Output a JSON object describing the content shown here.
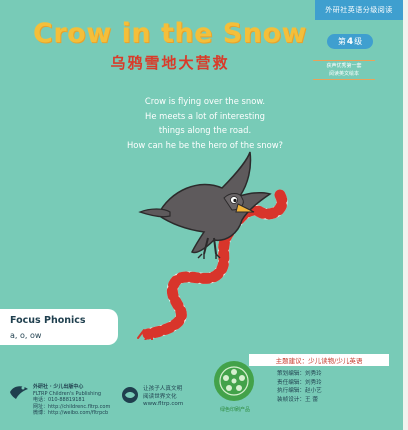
{
  "series_tab": "外研社英语分级阅读",
  "level": {
    "prefix": "第",
    "number": "4",
    "suffix": "级"
  },
  "award": [
    "获声优秀第一套",
    "阅读英文绘本"
  ],
  "title": "Crow in the Snow",
  "cn_title": "乌鸦雪地大营救",
  "blurb": [
    "Crow is flying over the snow.",
    "He meets a lot of interesting",
    "things along the road.",
    "How can he be the hero of the snow?"
  ],
  "phonics": {
    "title": "Focus Phonics",
    "sounds": "a, o, ow"
  },
  "ages": "主题建议：少儿读物/少儿英语",
  "credits": [
    "策划编辑：刘秀玲",
    "责任编辑：刘秀玲",
    "执行编辑：赵小艺",
    "装帧设计：王  蕾"
  ],
  "seal_text": "绿色印刷产品",
  "publisher": {
    "name": "外研社 · 少儿出版中心",
    "name_en": "FLTRP Children's Publishing",
    "lines": [
      "电话：010-88819181",
      "网址：http://childrenc.fltrp.com",
      "微博：http://weibo.com/fltrpcb"
    ]
  },
  "world": {
    "lines": [
      "让孩子人真文明",
      "阅读世界文化",
      "www.fltrp.com"
    ]
  },
  "colors": {
    "background": "#78cbb7",
    "title": "#f4bf3a",
    "cn_title": "#d93b2a",
    "tab": "#3f9fcf",
    "scarf_red": "#d8352b"
  },
  "icons": [
    "crow-illustration",
    "scarf-illustration",
    "green-seal-icon",
    "publisher-logo-icon",
    "world-logo-icon"
  ]
}
